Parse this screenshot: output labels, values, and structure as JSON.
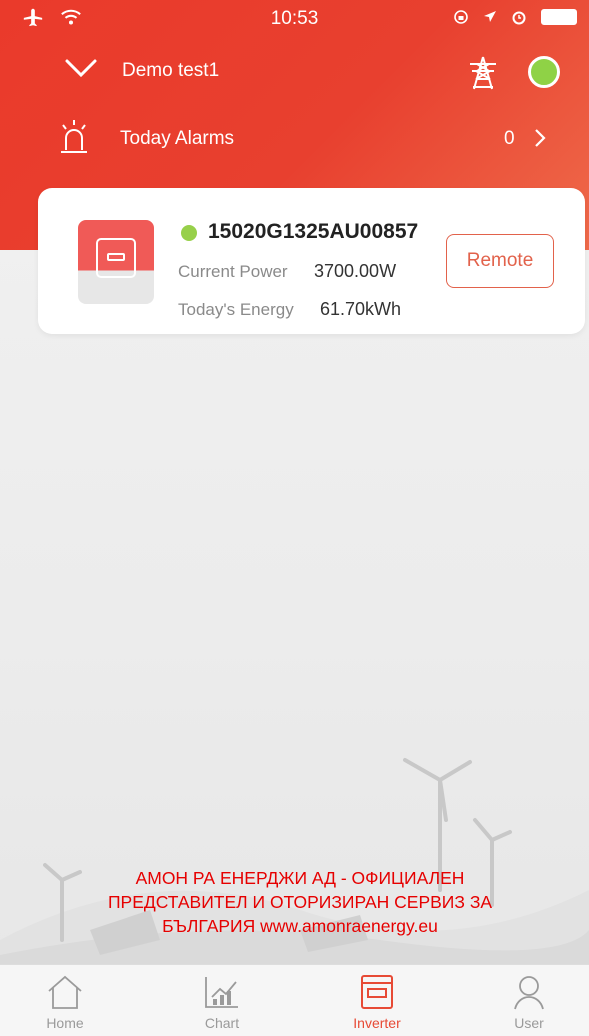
{
  "status_bar": {
    "time": "10:53"
  },
  "header": {
    "plant_name": "Demo test1",
    "alarm_label": "Today Alarms",
    "alarm_count": "0"
  },
  "inverter_card": {
    "serial": "15020G1325AU00857",
    "current_power_label": "Current Power",
    "current_power_value": "3700.00W",
    "todays_energy_label": "Today's Energy",
    "todays_energy_value": "61.70kWh",
    "remote_label": "Remote",
    "status_color": "#97d04a"
  },
  "watermark": {
    "line1": "АМОН РА ЕНЕРДЖИ АД - ОФИЦИАЛЕН",
    "line2": "ПРЕДСТАВИТЕЛ И ОТОРИЗИРАН СЕРВИЗ ЗА",
    "line3": "БЪЛГАРИЯ www.amonraenergy.eu"
  },
  "tabs": [
    {
      "label": "Home",
      "icon": "home-icon"
    },
    {
      "label": "Chart",
      "icon": "chart-icon"
    },
    {
      "label": "Inverter",
      "icon": "inverter-icon",
      "active": true
    },
    {
      "label": "User",
      "icon": "user-icon"
    }
  ],
  "colors": {
    "brand_red": "#e8402f",
    "accent_orange": "#e2624b",
    "online_green": "#8fd246"
  }
}
